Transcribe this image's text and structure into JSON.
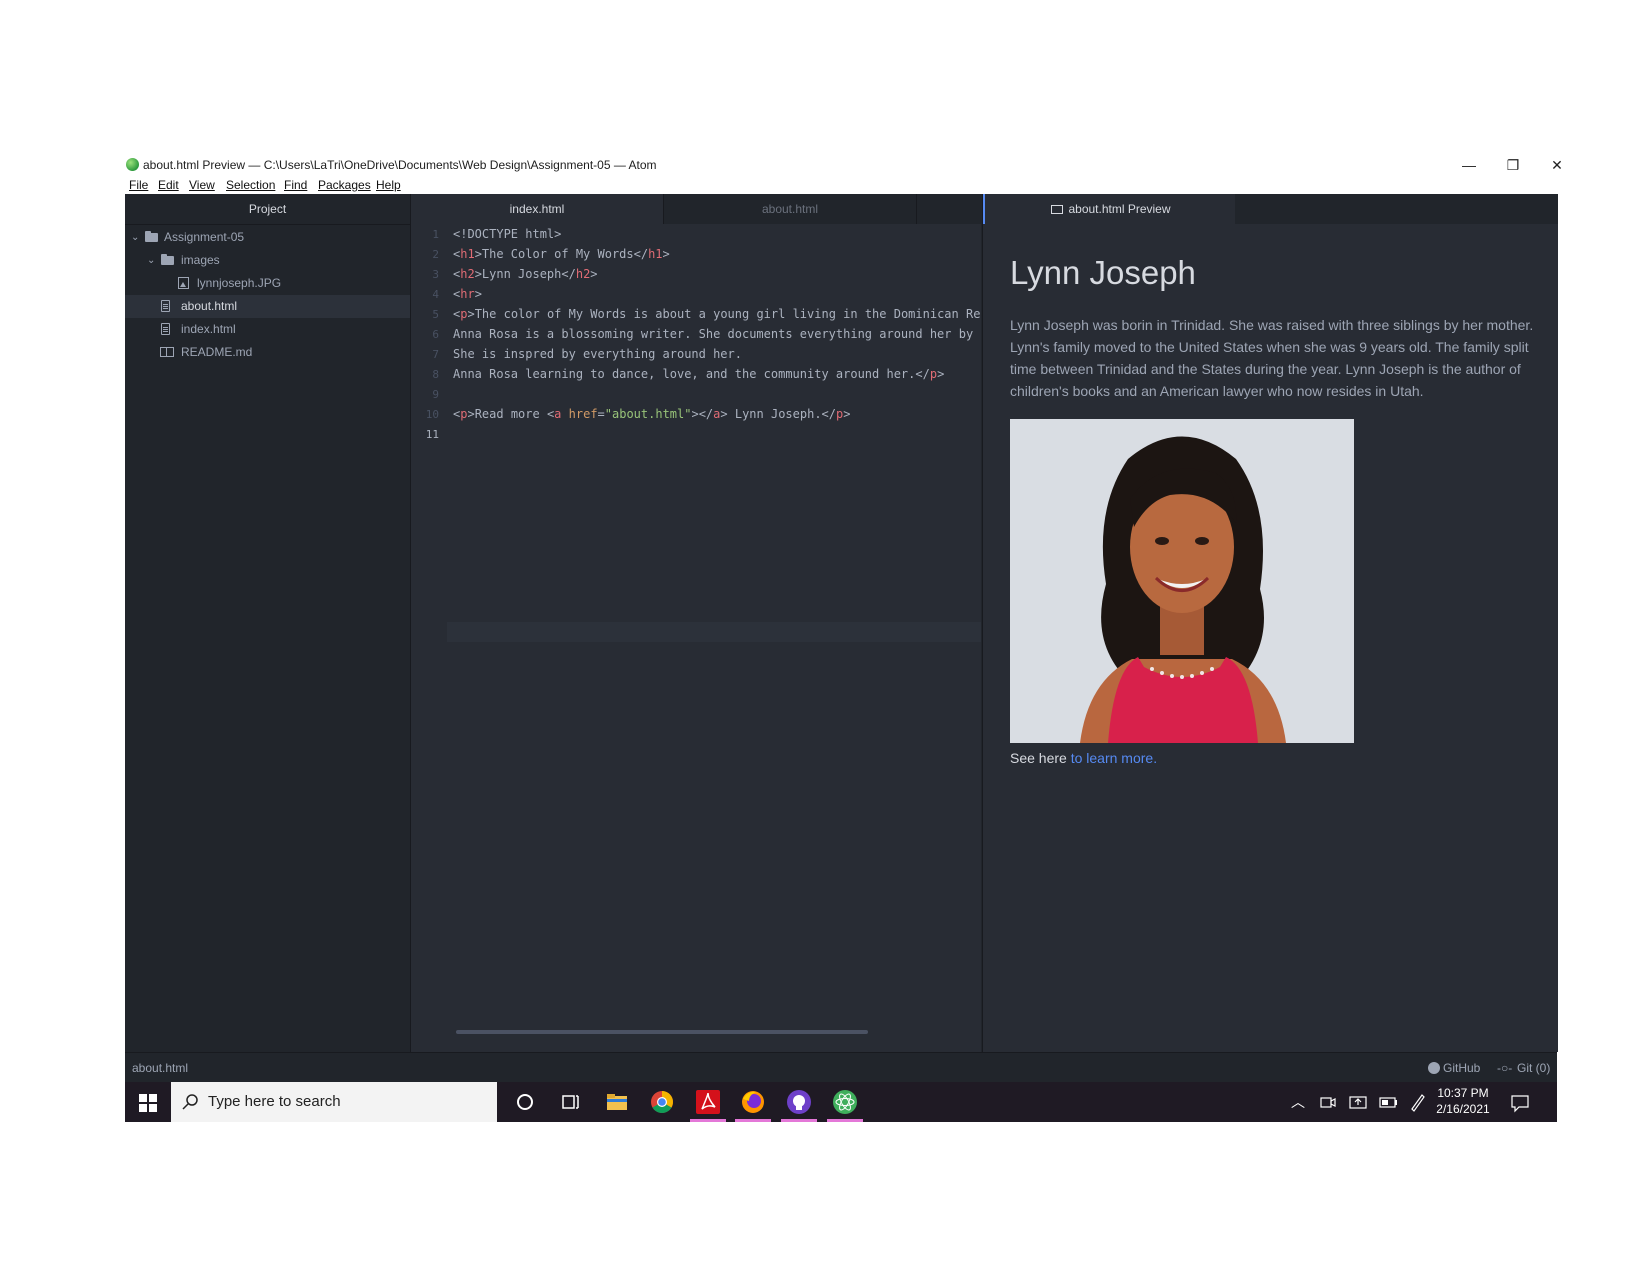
{
  "window": {
    "title": "about.html Preview — C:\\Users\\LaTri\\OneDrive\\Documents\\Web Design\\Assignment-05 — Atom",
    "controls": {
      "minimize": "—",
      "restore": "❐",
      "close": "✕"
    }
  },
  "menubar": [
    "File",
    "Edit",
    "View",
    "Selection",
    "Find",
    "Packages",
    "Help"
  ],
  "tree": {
    "header": "Project",
    "items": [
      {
        "label": "Assignment-05",
        "type": "folder"
      },
      {
        "label": "images",
        "type": "folder"
      },
      {
        "label": "lynnjoseph.JPG",
        "type": "image"
      },
      {
        "label": "about.html",
        "type": "file",
        "selected": true
      },
      {
        "label": "index.html",
        "type": "file"
      },
      {
        "label": "README.md",
        "type": "markdown"
      }
    ]
  },
  "editor": {
    "tabs": [
      {
        "label": "index.html",
        "active": true
      },
      {
        "label": "about.html",
        "active": false
      }
    ],
    "line_numbers": [
      "1",
      "2",
      "3",
      "4",
      "5",
      "6",
      "7",
      "8",
      "9",
      "10",
      "11"
    ],
    "code_lines": [
      "<!DOCTYPE html>",
      "<h1>The Color of My Words</h1>",
      "<h2>Lynn Joseph</h2>",
      "<hr>",
      "<p>The color of My Words is about a young girl living in the Dominican Re",
      "Anna Rosa is a blossoming writer. She documents everything around her by",
      "She is inspred by everything around her.",
      "Anna Rosa learning to dance, love, and the community around her.</p>",
      "",
      "<p>Read more <a href=\"about.html\"></a> Lynn Joseph.</p>",
      ""
    ]
  },
  "preview": {
    "tab_label": "about.html Preview",
    "heading": "Lynn Joseph",
    "paragraph": "Lynn Joseph was borin in Trinidad. She was raised with three siblings by her mother. Lynn's family moved to the United States when she was 9 years old. The family split time between Trinidad and the States during the year. Lynn Joseph is the author of children's books and an American lawyer who now resides in Utah.",
    "caption_prefix": "See here ",
    "caption_link": "to learn more."
  },
  "statusbar": {
    "file": "about.html",
    "github": "GitHub",
    "git": "Git (0)"
  },
  "taskbar": {
    "search_placeholder": "Type here to search",
    "time": "10:37 PM",
    "date": "2/16/2021"
  },
  "colors": {
    "editor_bg": "#282c34",
    "tree_bg": "#21252b",
    "accent": "#568af2",
    "taskbar_bg": "#1f1a24"
  }
}
